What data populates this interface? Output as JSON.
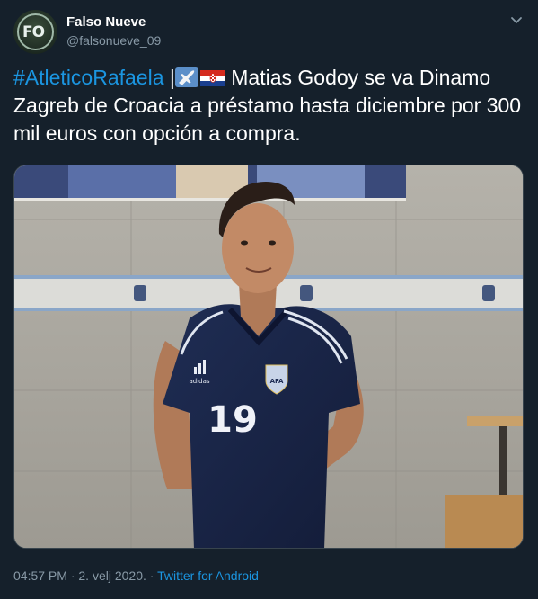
{
  "author": {
    "name": "Falso Nueve",
    "handle": "@falsonueve_09",
    "avatar_icon": "falso-nueve-logo",
    "avatar_text": "FO"
  },
  "tweet": {
    "hashtag": "#AtleticoRafaela",
    "separator": " |",
    "body": " Matias Godoy se va Dinamo Zagreb de Croacia a préstamo hasta diciembre por 300 mil euros con opción a compra.",
    "emoji_icons": [
      "airplane-icon",
      "croatia-flag-icon"
    ]
  },
  "media": {
    "jersey_number": "19",
    "shirt_brand": "adidas",
    "crest_text": "AFA"
  },
  "meta": {
    "time": "04:57 PM",
    "date": "2. velj 2020.",
    "dot": " · ",
    "source": "Twitter for Android"
  },
  "colors": {
    "background": "#15202b",
    "link": "#1b95e0",
    "secondary_text": "#8899a6"
  }
}
